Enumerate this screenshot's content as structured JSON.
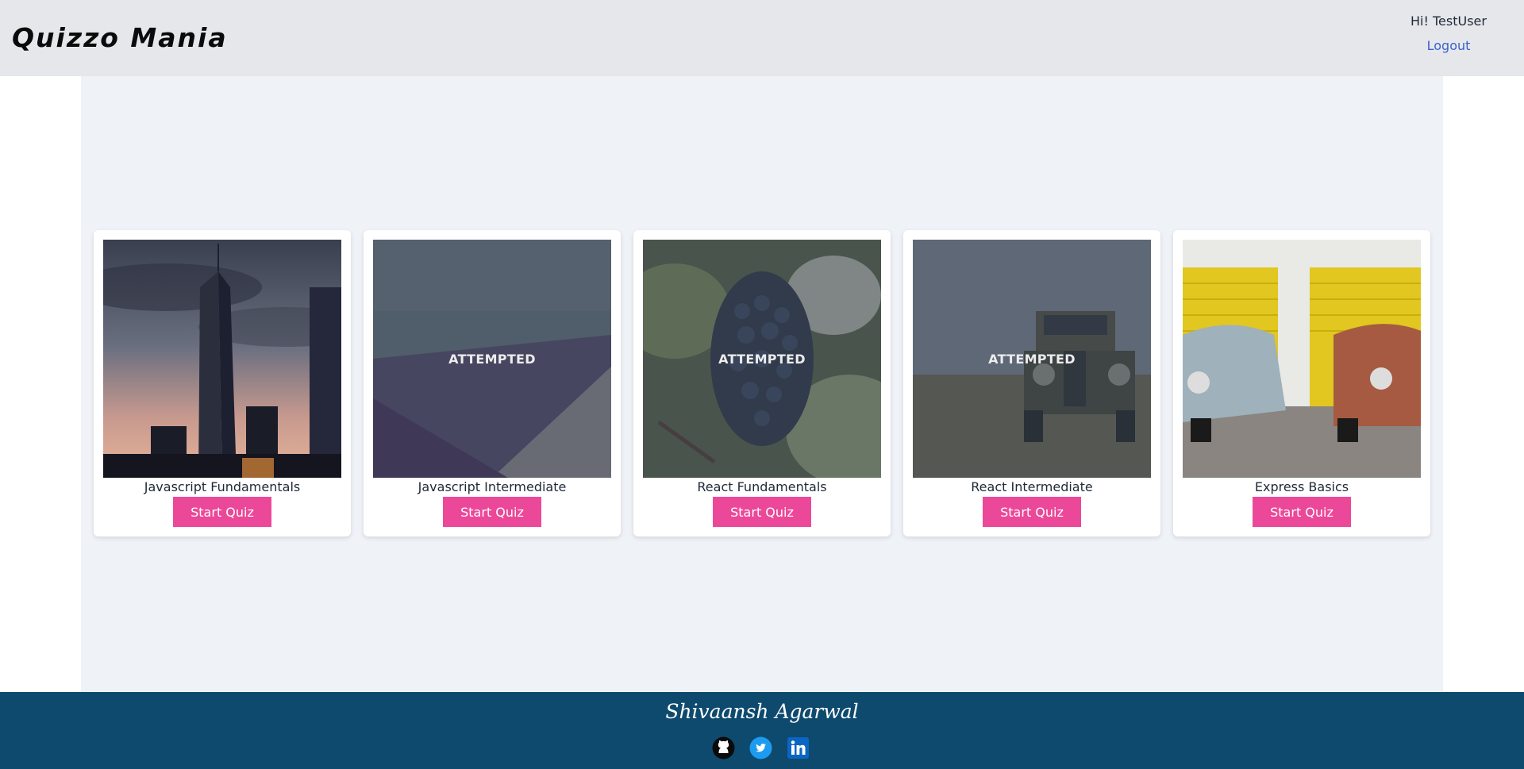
{
  "header": {
    "brand": "Quizzo Mania",
    "greeting": "Hi! TestUser",
    "logout_label": "Logout"
  },
  "quizzes": [
    {
      "title": "Javascript Fundamentals",
      "button_label": "Start Quiz",
      "attempted": false,
      "image": "city-skyscraper-image"
    },
    {
      "title": "Javascript Intermediate",
      "button_label": "Start Quiz",
      "attempted": true,
      "overlay_label": "ATTEMPTED",
      "image": "beach-shore-image"
    },
    {
      "title": "React Fundamentals",
      "button_label": "Start Quiz",
      "attempted": true,
      "overlay_label": "ATTEMPTED",
      "image": "grapes-vine-image"
    },
    {
      "title": "React Intermediate",
      "button_label": "Start Quiz",
      "attempted": true,
      "overlay_label": "ATTEMPTED",
      "image": "vintage-truck-image"
    },
    {
      "title": "Express Basics",
      "button_label": "Start Quiz",
      "attempted": false,
      "image": "vintage-cars-garage-image"
    }
  ],
  "footer": {
    "author": "Shivaansh Agarwal",
    "socials": [
      {
        "icon": "github-icon"
      },
      {
        "icon": "twitter-icon"
      },
      {
        "icon": "linkedin-icon"
      }
    ]
  },
  "colors": {
    "header_bg": "#e5e7eb",
    "main_bg": "#eff2f7",
    "button": "#ec4899",
    "footer_bg": "#0e4a6e",
    "link": "#3b5fc9"
  }
}
